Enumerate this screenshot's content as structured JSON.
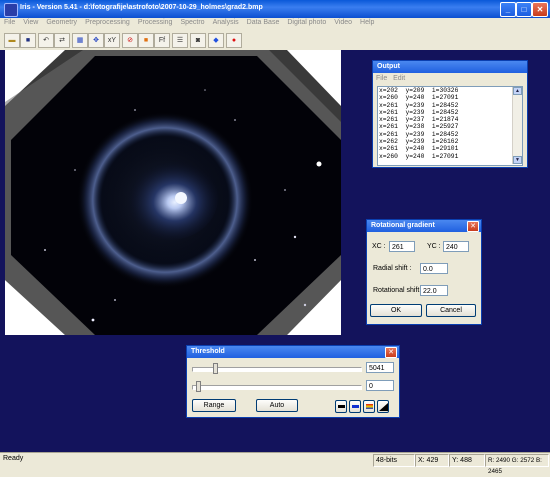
{
  "window": {
    "title": "Iris - Version 5.41 - d:\\fotografije\\astrofoto\\2007-10-29_holmes\\grad2.bmp",
    "minimize": "_",
    "maximize": "□",
    "close": "✕"
  },
  "menu": [
    "File",
    "View",
    "Geometry",
    "Preprocessing",
    "Processing",
    "Spectro",
    "Analysis",
    "Data Base",
    "Digital photo",
    "Video",
    "Help"
  ],
  "toolbar": {
    "icons": [
      "open-folder-icon",
      "save-disk-icon",
      "undo-icon",
      "redo-icon",
      "grid-icon",
      "move-icon",
      "xy-icon",
      "red-circle-icon",
      "orange-square-icon",
      "ab-icon",
      "list-icon",
      "camera-icon",
      "diamond-icon",
      "red-dot-icon"
    ],
    "glyphs": [
      "▬",
      "■",
      "↶",
      "⇄",
      "▦",
      "✥",
      "xY",
      "⊘",
      "■",
      "Ff",
      "☰",
      "◙",
      "◆",
      "●"
    ]
  },
  "output": {
    "title": "Output",
    "menu": [
      "File",
      "Edit"
    ],
    "rows": [
      "x=202  y=209  i=30326",
      "x=260  y=240  i=27091",
      "x=261  y=239  i=28452",
      "x=261  y=239  i=28452",
      "x=261  y=237  i=21874",
      "x=261  y=238  i=25927",
      "x=261  y=239  i=28452",
      "x=262  y=239  i=26162",
      "x=261  y=240  i=29101",
      "x=260  y=240  i=27091"
    ]
  },
  "rotational": {
    "title": "Rotational gradient",
    "xc_label": "XC :",
    "xc_value": "261",
    "yc_label": "YC :",
    "yc_value": "240",
    "radial_label": "Radial shift :",
    "radial_value": "0.0",
    "rot_label": "Rotational shift :",
    "rot_value": "22.0",
    "ok": "OK",
    "cancel": "Cancel"
  },
  "threshold": {
    "title": "Threshold",
    "high_value": "5041",
    "low_value": "0",
    "high_level": 0.13,
    "low_level": 0.0,
    "range": "Range",
    "auto": "Auto"
  },
  "status": {
    "ready": "Ready",
    "bits": "48-bits",
    "x": "X: 429",
    "y": "Y: 488",
    "rgb": "R: 2490  G: 2572  B: 2465"
  }
}
